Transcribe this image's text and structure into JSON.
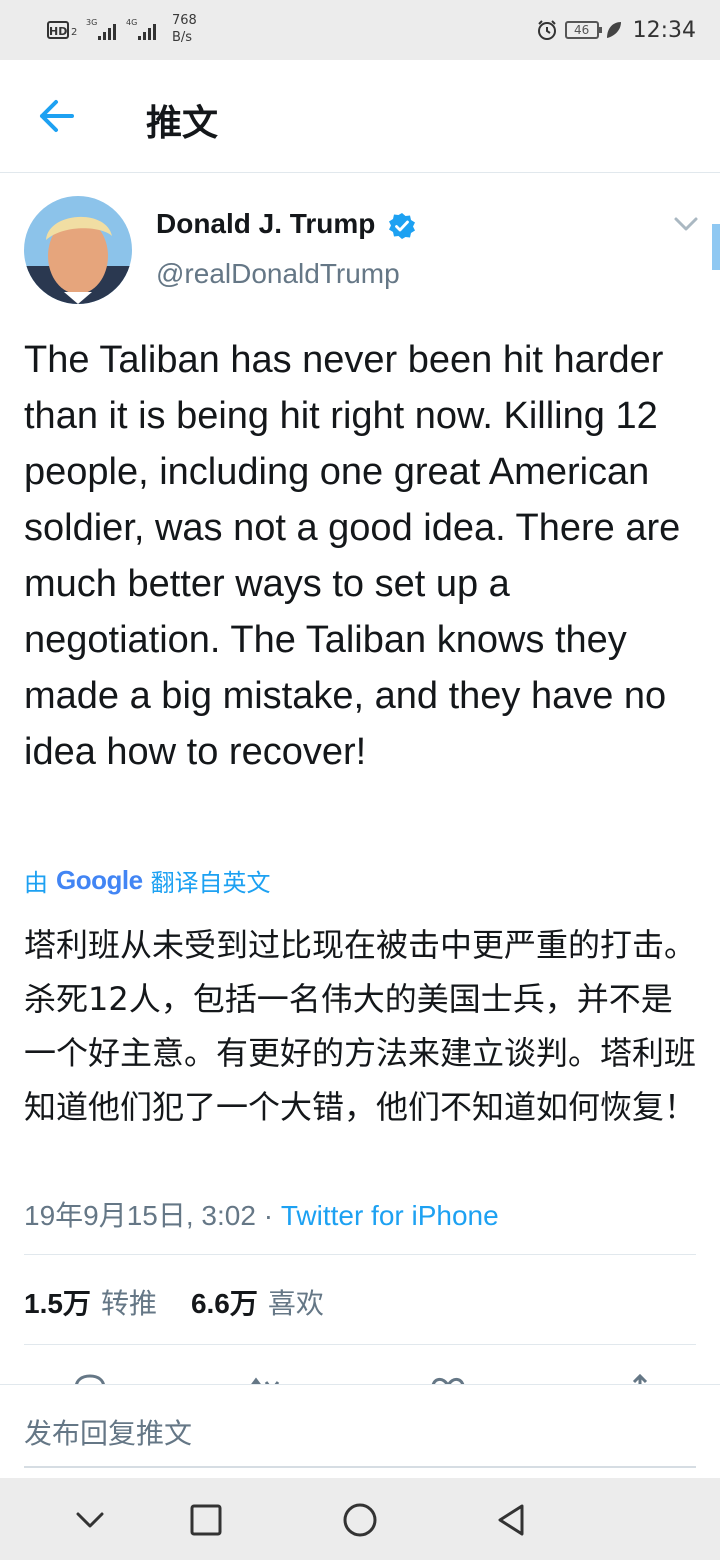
{
  "status_bar": {
    "hd": "HD",
    "sim_slot": "2",
    "signal1_type": "3G",
    "signal2_type": "4G",
    "speed_value": "768",
    "speed_unit": "B/s",
    "battery": "46",
    "time": "12:34"
  },
  "header": {
    "title": "推文"
  },
  "tweet": {
    "display_name": "Donald J. Trump",
    "handle": "@realDonaldTrump",
    "text": "The Taliban has never been hit harder than it is being hit right now. Killing 12 people, including one great American soldier, was not a good idea. There are much better ways to set up a negotiation. The Taliban knows they made a big mistake, and they have no idea how to recover!",
    "translate_prefix": "由",
    "translate_brand": "Google",
    "translate_suffix": "翻译自英文",
    "translated_text": "塔利班从未受到过比现在被击中更严重的打击。杀死12人，包括一名伟大的美国士兵，并不是一个好主意。有更好的方法来建立谈判。塔利班知道他们犯了一个大错，他们不知道如何恢复！",
    "date": "19年9月15日, 3:02",
    "separator": "·",
    "source": "Twitter for iPhone",
    "retweets_count": "1.5万",
    "retweets_label": "转推",
    "likes_count": "6.6万",
    "likes_label": "喜欢"
  },
  "reply": {
    "placeholder": "发布回复推文"
  },
  "colors": {
    "accent": "#1da1f2",
    "secondary_text": "#657786",
    "primary_text": "#14171a"
  }
}
